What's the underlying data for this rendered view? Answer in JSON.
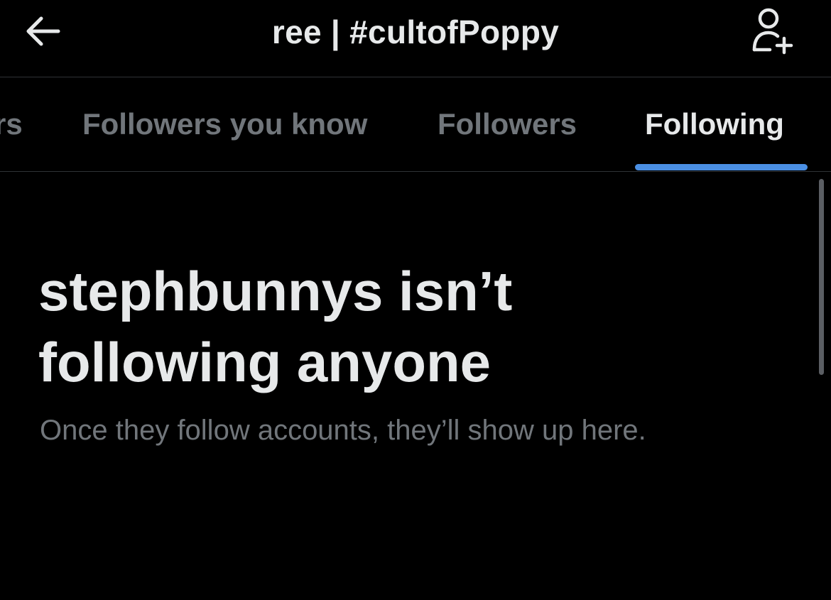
{
  "header": {
    "title": "ree | #cultofPoppy",
    "back_icon": "arrow-left-icon",
    "follow_icon": "person-add-icon"
  },
  "tabs": [
    {
      "label": "rs",
      "active": false
    },
    {
      "label": "Followers you know",
      "active": false
    },
    {
      "label": "Followers",
      "active": false
    },
    {
      "label": "Following",
      "active": true
    }
  ],
  "empty_state": {
    "title_line1": "stephbunnys isn’t",
    "title_line2": "following anyone",
    "subtitle": "Once they follow accounts, they’ll show up here."
  },
  "colors": {
    "background": "#000000",
    "primary_text": "#e7e9ea",
    "secondary_text": "#71767b",
    "accent": "#4a8fe3",
    "divider": "#2f3336"
  }
}
